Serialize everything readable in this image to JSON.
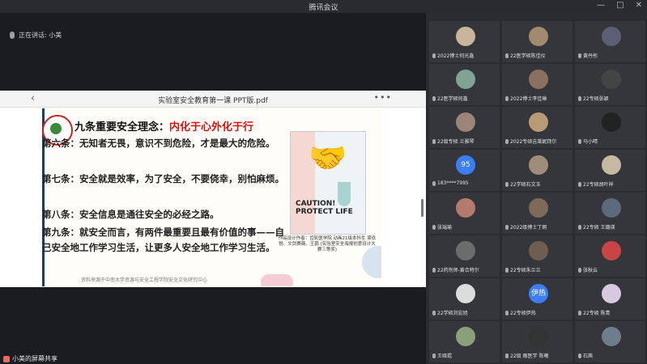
{
  "window": {
    "title": "腾讯会议",
    "controls": [
      "—",
      "□",
      "✕"
    ]
  },
  "speaker": {
    "label": "正在讲话: 小美"
  },
  "document": {
    "title": "实验室安全教育第一课 PPT版.pdf",
    "back_icon": "chevron-left-icon",
    "more_icon": "more-dots-icon"
  },
  "slide": {
    "heading_prefix": "九条重要安全理念：",
    "heading_highlight": "内化于心外化于行",
    "rules": [
      "第六条：无知者无畏，意识不到危险，才是最大的危险。",
      "第七条：安全就是效率，为了安全，不要侥幸，别怕麻烦。",
      "第八条：安全信息是通往安全的必经之路。",
      "第九条：就安全而言，有两件最重要且最有价值的事——自己安全地工作学习生活，让更多人安全地工作学习生活。"
    ],
    "poster_text": "CAUTION! PROTECT LIFE",
    "poster_caption": "作品设计作者：齿轮医学院 动画21级本科生 梁玖悦、文剑赛薇、王鹊 (实验室安全海报创意设计大赛三等奖)",
    "source_note": "资料来源于中南大学资源与安全工程学院安全文化研究中心"
  },
  "bottom": {
    "share_label": "小美的屏幕共享"
  },
  "participants": [
    {
      "name": "2022博士何光鑫",
      "color": "#c9b59b"
    },
    {
      "name": "22医学硕陈佳仪",
      "color": "#a18a6e"
    },
    {
      "name": "黄丹彤",
      "color": "#5a5f73"
    },
    {
      "name": "22医学硕何鑫",
      "color": "#7fa394"
    },
    {
      "name": "2022博士李佳琳",
      "color": "#8b7060"
    },
    {
      "name": "22专硕张颖",
      "color": "#444444"
    },
    {
      "name": "22级专硕 兰雅琴",
      "color": "#9c8576"
    },
    {
      "name": "2022专硕吉莱妮拜尔",
      "color": "#b89a75"
    },
    {
      "name": "马小晴",
      "color": "#222222"
    },
    {
      "name": "183****7995",
      "avatar_text": "95",
      "color": "#3b7ef5"
    },
    {
      "name": "22学硕石文玉",
      "color": "#a08c7a"
    },
    {
      "name": "22专硕胡叶祥",
      "color": "#c7b8a3"
    },
    {
      "name": "张瑞瑜",
      "color": "#b47a6c"
    },
    {
      "name": "2022级博士丁炯",
      "color": "#7d6a58"
    },
    {
      "name": "22专硕 王璐瑛",
      "color": "#5d6a7b"
    },
    {
      "name": "22药剂师-黄合特尔",
      "color": "#6c6c6c"
    },
    {
      "name": "22专硕朱兰兰",
      "color": "#6e5e51"
    },
    {
      "name": "张秋云",
      "color": "#c94545"
    },
    {
      "name": "22学硕刘宏旭",
      "color": "#dcdcdc"
    },
    {
      "name": "22专硕伊热",
      "avatar_text": "伊热",
      "color": "#3b7ef5"
    },
    {
      "name": "22专硕 陈青",
      "color": "#d6c9e0"
    },
    {
      "name": "王娅琨",
      "color": "#8aa07a"
    },
    {
      "name": "22级 眼医学 陈曦",
      "color": "#333333"
    },
    {
      "name": "石茜",
      "color": "#6d7d8c"
    }
  ]
}
